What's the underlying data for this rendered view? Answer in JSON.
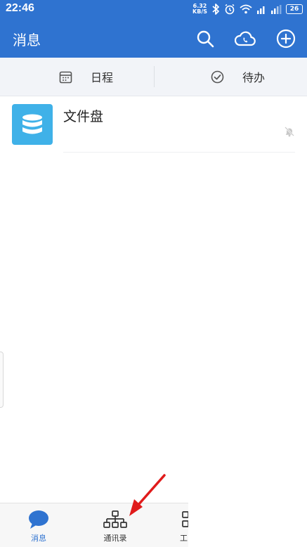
{
  "status_bar": {
    "time": "22:46",
    "net_speed_value": "6.32",
    "net_speed_unit": "KB/S",
    "battery": "26"
  },
  "app_bar": {
    "title": "消息",
    "actions": [
      "search-icon",
      "cloud-phone-icon",
      "add-circle-icon"
    ]
  },
  "sub_tabs": [
    {
      "label": "日程",
      "icon": "calendar-icon"
    },
    {
      "label": "待办",
      "icon": "check-circle-icon"
    }
  ],
  "conversations": [
    {
      "name": "文件盘",
      "icon": "database-icon",
      "muted": true
    }
  ],
  "bottom_nav": [
    {
      "label": "消息",
      "icon": "chat-bubble-icon",
      "active": true
    },
    {
      "label": "通讯录",
      "icon": "org-chart-icon",
      "active": false
    },
    {
      "label": "工",
      "icon": "apps-icon",
      "active": false
    }
  ],
  "colors": {
    "primary": "#2f73d0",
    "avatar": "#3fb1e8",
    "annotation_arrow": "#e01b1b"
  }
}
